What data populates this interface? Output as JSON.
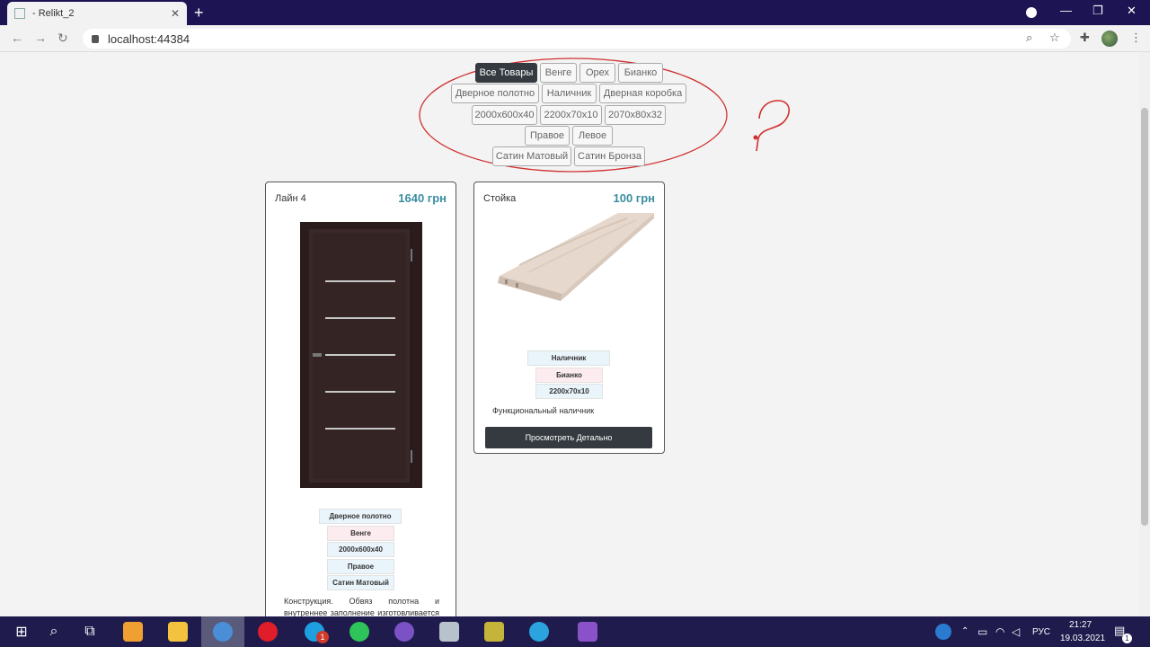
{
  "browser": {
    "tab_title": "- Relikt_2",
    "tab_close": "✕",
    "new_tab": "+",
    "url": "localhost:44384",
    "win_controls": [
      "—",
      "❐",
      "✕"
    ]
  },
  "filters": {
    "row1": [
      "Все Товары",
      "Венге",
      "Орех",
      "Бианко"
    ],
    "row2": [
      "Дверное полотно",
      "Наличник",
      "Дверная коробка"
    ],
    "row3": [
      "2000x600x40",
      "2200x70x10",
      "2070x80x32"
    ],
    "row4": [
      "Правое",
      "Левое"
    ],
    "row5": [
      "Сатин Матовый",
      "Сатин Бронза"
    ]
  },
  "annotation": {
    "question_mark": "?",
    "color": "#d03030"
  },
  "products": [
    {
      "name": "Лайн 4",
      "price": "1640 грн",
      "tags": [
        "Дверное полотно",
        "Венге",
        "2000x600x40",
        "Правое",
        "Сатин Матовый"
      ],
      "description": "Конструкция. Обвяз полотна и внутреннее заполнение изготовливается из сращенного"
    },
    {
      "name": "Стойка",
      "price": "100 грн",
      "tags": [
        "Наличник",
        "Бианко",
        "2200x70x10"
      ],
      "description": "Функциональный наличник",
      "button": "Просмотреть Детально"
    }
  ],
  "taskbar": {
    "lang": "РУС",
    "time": "21:27",
    "date": "19.03.2021",
    "notification_count": "1",
    "skype_badge": "1"
  },
  "colors": {
    "accent_price": "#3a8ea0",
    "dark_button": "#343a40",
    "titlebar": "#1d1453"
  }
}
